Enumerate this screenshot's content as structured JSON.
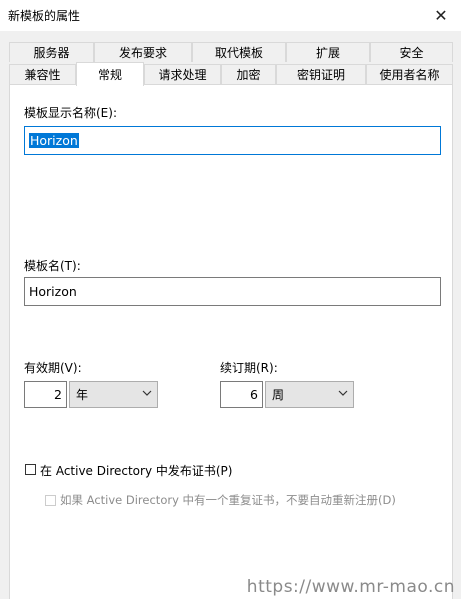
{
  "window": {
    "title": "新模板的属性",
    "close_glyph": "✕"
  },
  "tabs_top": [
    "服务器",
    "发布要求",
    "取代模板",
    "扩展",
    "安全"
  ],
  "tabs_bottom": [
    "兼容性",
    "常规",
    "请求处理",
    "加密",
    "密钥证明",
    "使用者名称"
  ],
  "active_tab": "常规",
  "general": {
    "display_name_label": "模板显示名称(E):",
    "display_name_value": "Horizon",
    "template_name_label": "模板名(T):",
    "template_name_value": "Horizon",
    "validity_label": "有效期(V):",
    "validity_value": "2",
    "validity_unit": "年",
    "renewal_label": "续订期(R):",
    "renewal_value": "6",
    "renewal_unit": "周",
    "publish_ad_label": "在 Active Directory 中发布证书(P)",
    "publish_ad_checked": false,
    "no_reenroll_label": "如果 Active Directory 中有一个重复证书，不要自动重新注册(D)",
    "no_reenroll_checked": false
  },
  "watermark": "https://www.mr-mao.cn"
}
